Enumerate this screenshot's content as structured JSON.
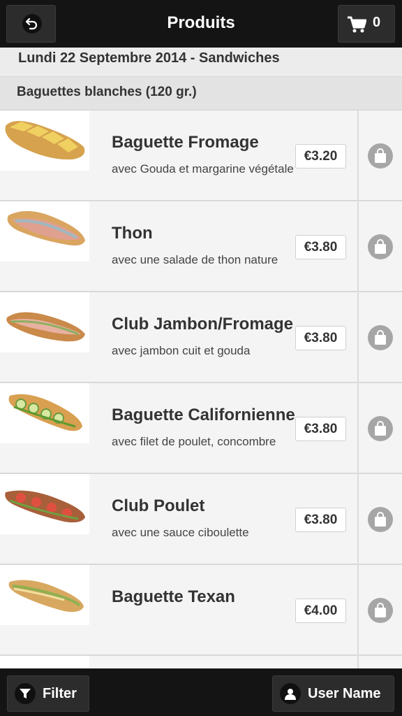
{
  "header": {
    "title": "Produits",
    "back_icon": "back-arrow-icon",
    "cart_icon": "cart-icon",
    "cart_count": "0"
  },
  "date_header": "Lundi 22 Septembre 2014 - Sandwiches",
  "category_header": "Baguettes blanches (120 gr.)",
  "products": [
    {
      "name": "Baguette Fromage",
      "description": "avec Gouda et margarine végétale",
      "price": "€3.20",
      "image": "baguette-fromage-image"
    },
    {
      "name": "Thon",
      "description": "avec une salade de thon nature",
      "price": "€3.80",
      "image": "thon-image"
    },
    {
      "name": "Club Jambon/Fromage",
      "description": "avec jambon cuit et gouda",
      "price": "€3.80",
      "image": "club-jambon-fromage-image"
    },
    {
      "name": "Baguette Californienne",
      "description": "avec filet de poulet, concombre",
      "price": "€3.80",
      "image": "baguette-californienne-image"
    },
    {
      "name": "Club Poulet",
      "description": "avec une sauce ciboulette",
      "price": "€3.80",
      "image": "club-poulet-image"
    },
    {
      "name": "Baguette Texan",
      "description": "",
      "price": "€4.00",
      "image": "baguette-texan-image"
    }
  ],
  "footer": {
    "filter_label": "Filter",
    "user_label": "User Name",
    "filter_icon": "funnel-icon",
    "user_icon": "user-icon"
  }
}
